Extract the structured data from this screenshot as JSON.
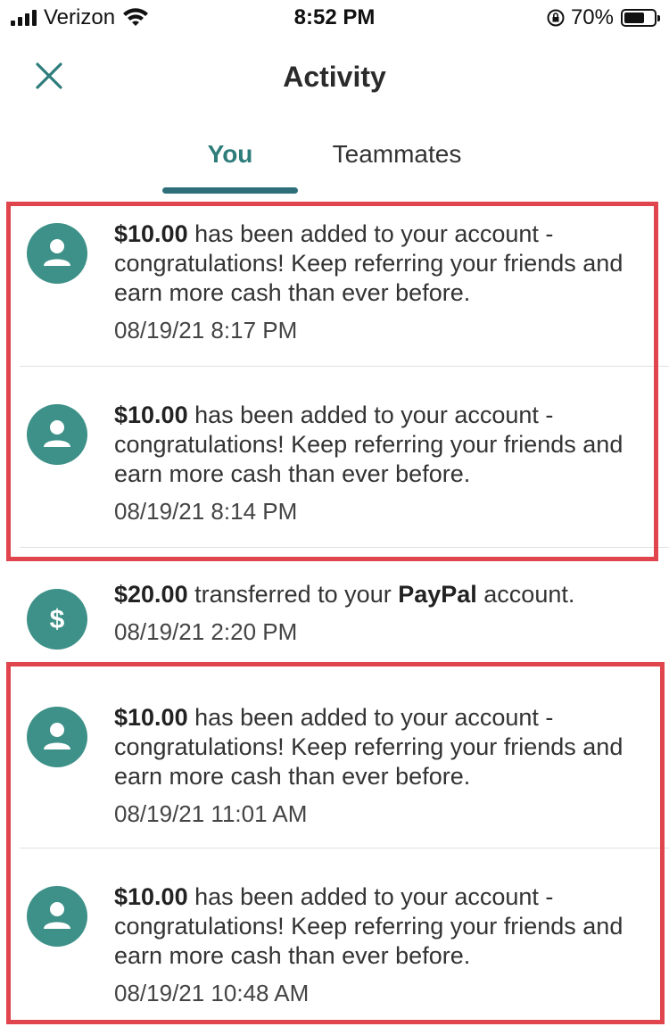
{
  "status_bar": {
    "carrier": "Verizon",
    "time": "8:52 PM",
    "battery_percent": "70%",
    "battery_level": 0.7
  },
  "header": {
    "title": "Activity"
  },
  "tabs": [
    {
      "label": "You",
      "active": true
    },
    {
      "label": "Teammates",
      "active": false
    }
  ],
  "feed": [
    {
      "icon": "person-icon",
      "amount": "$10.00",
      "text": " has been added to your account - congratulations! Keep referring your friends and earn more cash than ever before.",
      "date": "08/19/21 8:17 PM"
    },
    {
      "icon": "person-icon",
      "amount": "$10.00",
      "text": " has been added to your account - congratulations! Keep referring your friends and earn more cash than ever before.",
      "date": "08/19/21 8:14 PM"
    },
    {
      "icon": "dollar-icon",
      "amount": "$20.00",
      "text_before": " transferred to your ",
      "service": "PayPal",
      "text_after": " account.",
      "date": "08/19/21 2:20 PM"
    },
    {
      "icon": "person-icon",
      "amount": "$10.00",
      "text": " has been added to your account - congratulations! Keep referring your friends and earn more cash than ever before.",
      "date": "08/19/21 11:01 AM"
    },
    {
      "icon": "person-icon",
      "amount": "$10.00",
      "text": " has been added to your account - congratulations! Keep referring your friends and earn more cash than ever before.",
      "date": "08/19/21 10:48 AM"
    }
  ],
  "colors": {
    "accent": "#2e7d7b",
    "avatar": "#3d9188",
    "highlight": "#e0454d"
  }
}
